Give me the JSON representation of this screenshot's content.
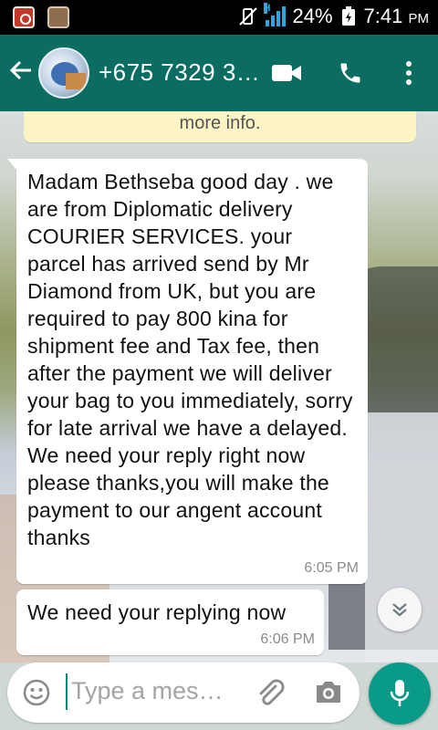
{
  "status_bar": {
    "battery": "24%",
    "network": "H",
    "time": "7:41",
    "ampm": "PM"
  },
  "header": {
    "contact": "+675 7329 3…",
    "icons": [
      "back-arrow-icon",
      "video-call-icon",
      "phone-icon",
      "overflow-menu-icon"
    ]
  },
  "chat": {
    "info_banner": "more info.",
    "messages": [
      {
        "text": "Madam Bethseba good day . we are from Diplomatic delivery COURIER SERVICES. your parcel has arrived send by Mr Diamond   from UK,  but you are required to pay 800 kina for shipment fee and Tax fee,  then after the payment we will deliver your bag to you immediately, sorry for late arrival we have a delayed. We need your reply right now please thanks,you will make the payment to  our angent account thanks",
        "time": "6:05 PM"
      },
      {
        "text": "We need your replying now",
        "time": "6:06 PM"
      }
    ]
  },
  "composer": {
    "placeholder": "Type a mes…"
  },
  "colors": {
    "header": "#0b6d62",
    "accent": "#0a9a88",
    "banner": "#fdf4c5"
  }
}
